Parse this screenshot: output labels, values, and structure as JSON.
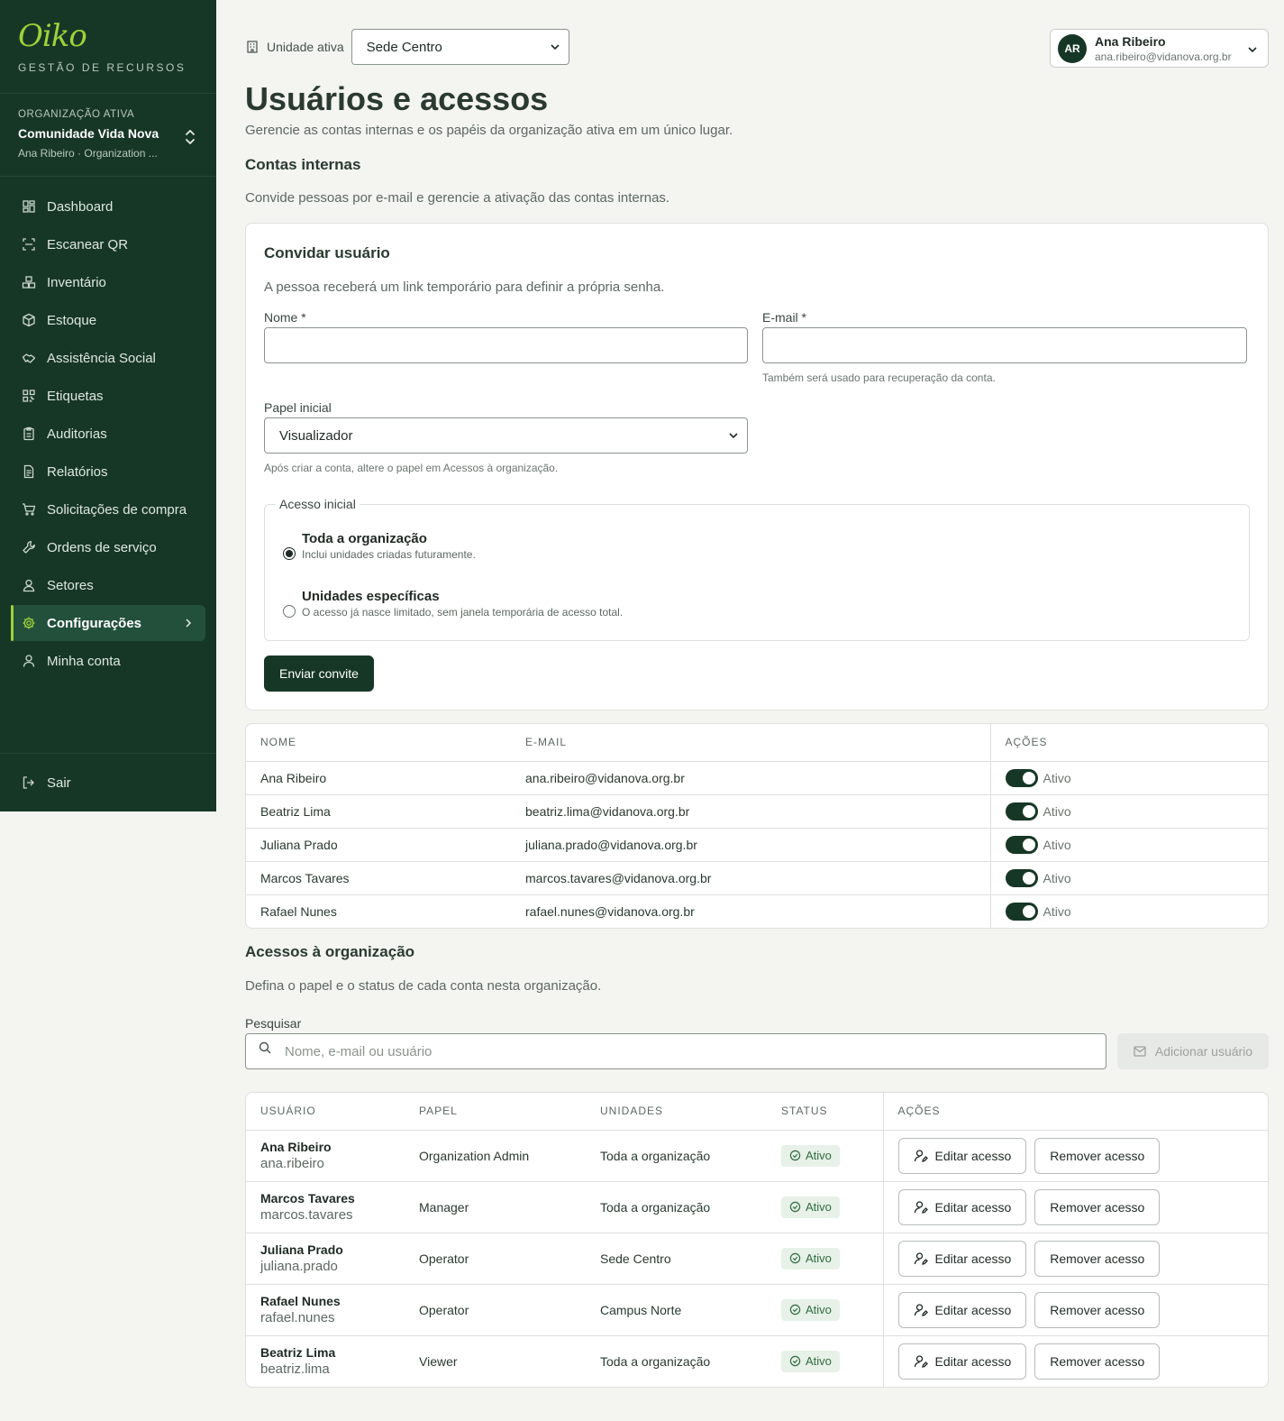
{
  "sidebar": {
    "logo": "Oiko",
    "tagline": "GESTÃO DE RECURSOS",
    "org_label": "ORGANIZAÇÃO ATIVA",
    "org_name": "Comunidade Vida Nova",
    "org_user": "Ana Ribeiro · Organization ...",
    "items": [
      {
        "label": "Dashboard",
        "icon": "dashboard-icon"
      },
      {
        "label": "Escanear QR",
        "icon": "scan-icon"
      },
      {
        "label": "Inventário",
        "icon": "boxes-icon"
      },
      {
        "label": "Estoque",
        "icon": "package-icon"
      },
      {
        "label": "Assistência Social",
        "icon": "handshake-icon"
      },
      {
        "label": "Etiquetas",
        "icon": "qr-code-icon"
      },
      {
        "label": "Auditorias",
        "icon": "clipboard-icon"
      },
      {
        "label": "Relatórios",
        "icon": "report-icon"
      },
      {
        "label": "Solicitações de compra",
        "icon": "cart-icon"
      },
      {
        "label": "Ordens de serviço",
        "icon": "wrench-icon"
      },
      {
        "label": "Setores",
        "icon": "users-icon"
      },
      {
        "label": "Configurações",
        "icon": "gear-icon",
        "active": true
      },
      {
        "label": "Minha conta",
        "icon": "user-icon"
      }
    ],
    "logout": "Sair"
  },
  "topbar": {
    "unit_label": "Unidade ativa",
    "unit_value": "Sede Centro",
    "user_initials": "AR",
    "user_name": "Ana Ribeiro",
    "user_email": "ana.ribeiro@vidanova.org.br"
  },
  "page": {
    "title": "Usuários e acessos",
    "subtitle": "Gerencie as contas internas e os papéis da organização ativa em um único lugar."
  },
  "internal": {
    "title": "Contas internas",
    "desc": "Convide pessoas por e-mail e gerencie a ativação das contas internas.",
    "invite": {
      "title": "Convidar usuário",
      "desc": "A pessoa receberá um link temporário para definir a própria senha.",
      "name_label": "Nome *",
      "name_value": "",
      "email_label": "E-mail *",
      "email_value": "",
      "email_hint": "Também será usado para recuperação da conta.",
      "role_label": "Papel inicial",
      "role_value": "Visualizador",
      "role_hint": "Após criar a conta, altere o papel em Acessos à organização.",
      "access_legend": "Acesso inicial",
      "option_all_title": "Toda a organização",
      "option_all_sub": "Inclui unidades criadas futuramente.",
      "option_units_title": "Unidades específicas",
      "option_units_sub": "O acesso já nasce limitado, sem janela temporária de acesso total.",
      "selected_option": "Toda a organização",
      "submit": "Enviar convite"
    },
    "table": {
      "headers": {
        "name": "NOME",
        "email": "E-MAIL",
        "actions": "AÇÕES"
      },
      "rows": [
        {
          "name": "Ana Ribeiro",
          "email": "ana.ribeiro@vidanova.org.br",
          "status": "Ativo"
        },
        {
          "name": "Beatriz Lima",
          "email": "beatriz.lima@vidanova.org.br",
          "status": "Ativo"
        },
        {
          "name": "Juliana Prado",
          "email": "juliana.prado@vidanova.org.br",
          "status": "Ativo"
        },
        {
          "name": "Marcos Tavares",
          "email": "marcos.tavares@vidanova.org.br",
          "status": "Ativo"
        },
        {
          "name": "Rafael Nunes",
          "email": "rafael.nunes@vidanova.org.br",
          "status": "Ativo"
        }
      ]
    }
  },
  "access": {
    "title": "Acessos à organização",
    "desc": "Defina o papel e o status de cada conta nesta organização.",
    "search_label": "Pesquisar",
    "search_placeholder": "Nome, e-mail ou usuário",
    "add_button": "Adicionar usuário",
    "table": {
      "headers": {
        "user": "USUÁRIO",
        "role": "PAPEL",
        "units": "UNIDADES",
        "status": "STATUS",
        "actions": "AÇÕES"
      },
      "edit_label": "Editar acesso",
      "remove_label": "Remover acesso",
      "rows": [
        {
          "name": "Ana Ribeiro",
          "login": "ana.ribeiro",
          "role": "Organization Admin",
          "units": "Toda a organização",
          "status": "Ativo"
        },
        {
          "name": "Marcos Tavares",
          "login": "marcos.tavares",
          "role": "Manager",
          "units": "Toda a organização",
          "status": "Ativo"
        },
        {
          "name": "Juliana Prado",
          "login": "juliana.prado",
          "role": "Operator",
          "units": "Sede Centro",
          "status": "Ativo"
        },
        {
          "name": "Rafael Nunes",
          "login": "rafael.nunes",
          "role": "Operator",
          "units": "Campus Norte",
          "status": "Ativo"
        },
        {
          "name": "Beatriz Lima",
          "login": "beatriz.lima",
          "role": "Viewer",
          "units": "Toda a organização",
          "status": "Ativo"
        }
      ]
    }
  },
  "colors": {
    "sidebar_bg": "#173726",
    "accent": "#9fd23a",
    "primary_button": "#173726",
    "status_badge": "#e7f1e8"
  }
}
